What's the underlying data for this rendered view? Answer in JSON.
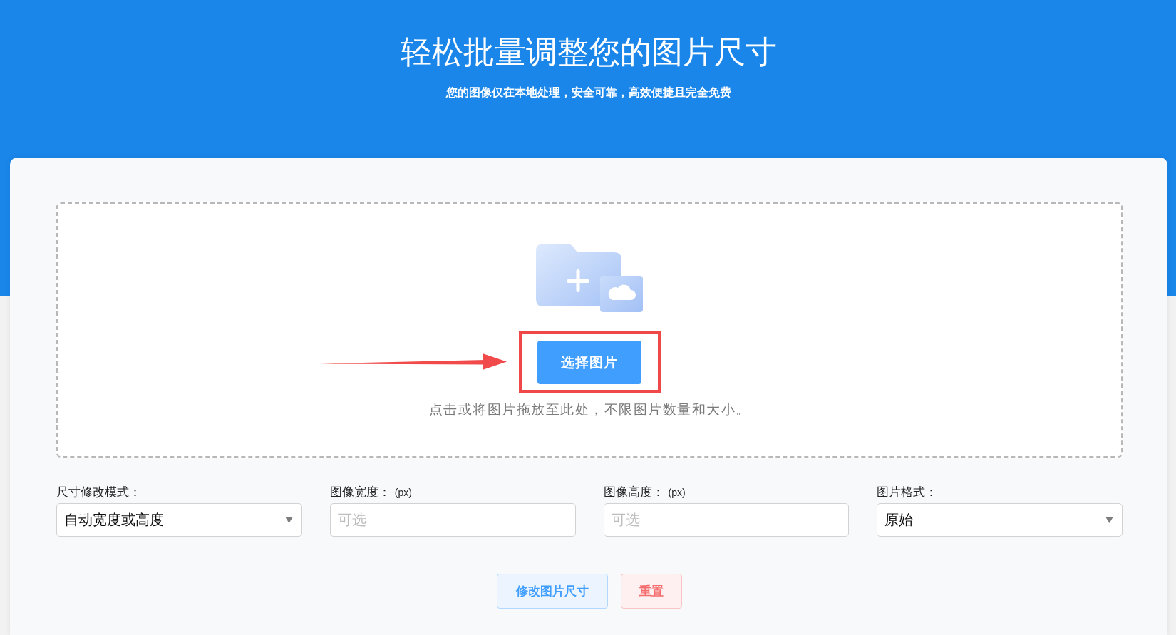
{
  "header": {
    "title": "轻松批量调整您的图片尺寸",
    "subtitle": "您的图像仅在本地处理，安全可靠，高效便捷且完全免费"
  },
  "upload": {
    "button": {
      "label": "选择图片",
      "highlighted": true
    },
    "hint": "点击或将图片拖放至此处，不限图片数量和大小。"
  },
  "settings": [
    {
      "kind": "select",
      "label": "尺寸修改模式：",
      "value": "自动宽度或高度"
    },
    {
      "kind": "input",
      "label": "图像宽度：",
      "unit": "(px)",
      "placeholder": "可选"
    },
    {
      "kind": "input",
      "label": "图像高度：",
      "unit": "(px)",
      "placeholder": "可选"
    },
    {
      "kind": "select",
      "label": "图片格式：",
      "value": "原始"
    }
  ],
  "actions": [
    {
      "kind": "primary",
      "label": "修改图片尺寸"
    },
    {
      "kind": "danger",
      "label": "重置"
    }
  ]
}
